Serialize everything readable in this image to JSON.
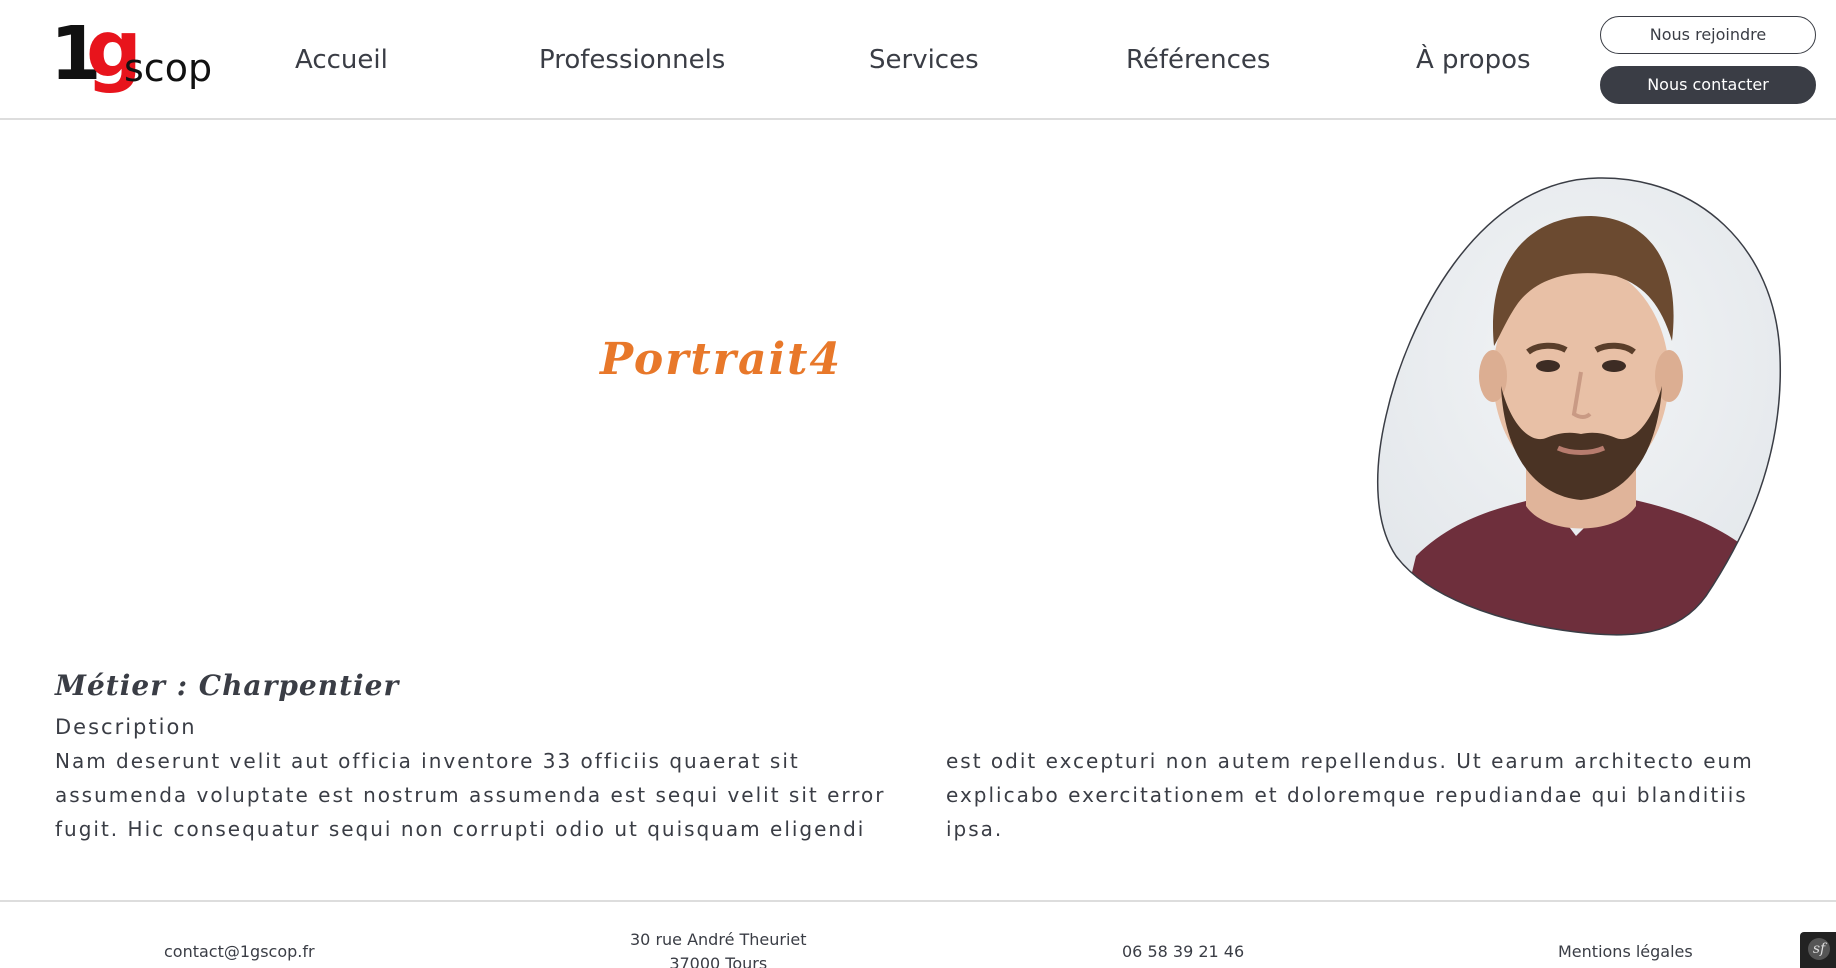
{
  "logo": {
    "one": "1",
    "g": "g",
    "scop": "scop"
  },
  "nav": {
    "items": [
      {
        "label": "Accueil"
      },
      {
        "label": "Professionnels"
      },
      {
        "label": "Services"
      },
      {
        "label": "Références"
      },
      {
        "label": "À propos"
      }
    ]
  },
  "header_buttons": {
    "join_label": "Nous rejoindre",
    "contact_label": "Nous contacter"
  },
  "main": {
    "title": "Portrait4",
    "job": "Métier : Charpentier",
    "description_label": "Description",
    "description_text": "Nam deserunt velit aut officia inventore 33 officiis quaerat sit assumenda voluptate est nostrum assumenda est sequi velit sit error fugit. Hic consequatur sequi non corrupti odio ut quisquam eligendi est odit excepturi non autem repellendus. Ut earum architecto eum explicabo exercitationem et doloremque repudiandae qui blanditiis ipsa."
  },
  "footer": {
    "email": "contact@1gscop.fr",
    "address_line1": "30 rue André Theuriet",
    "address_line2": "37000 Tours",
    "phone": "06 58 39 21 46",
    "legal": "Mentions légales"
  },
  "debug_badge": {
    "glyph": "sf"
  },
  "colors": {
    "accent_orange": "#e8782a",
    "logo_red": "#e8141c",
    "dark": "#3a3d45"
  }
}
